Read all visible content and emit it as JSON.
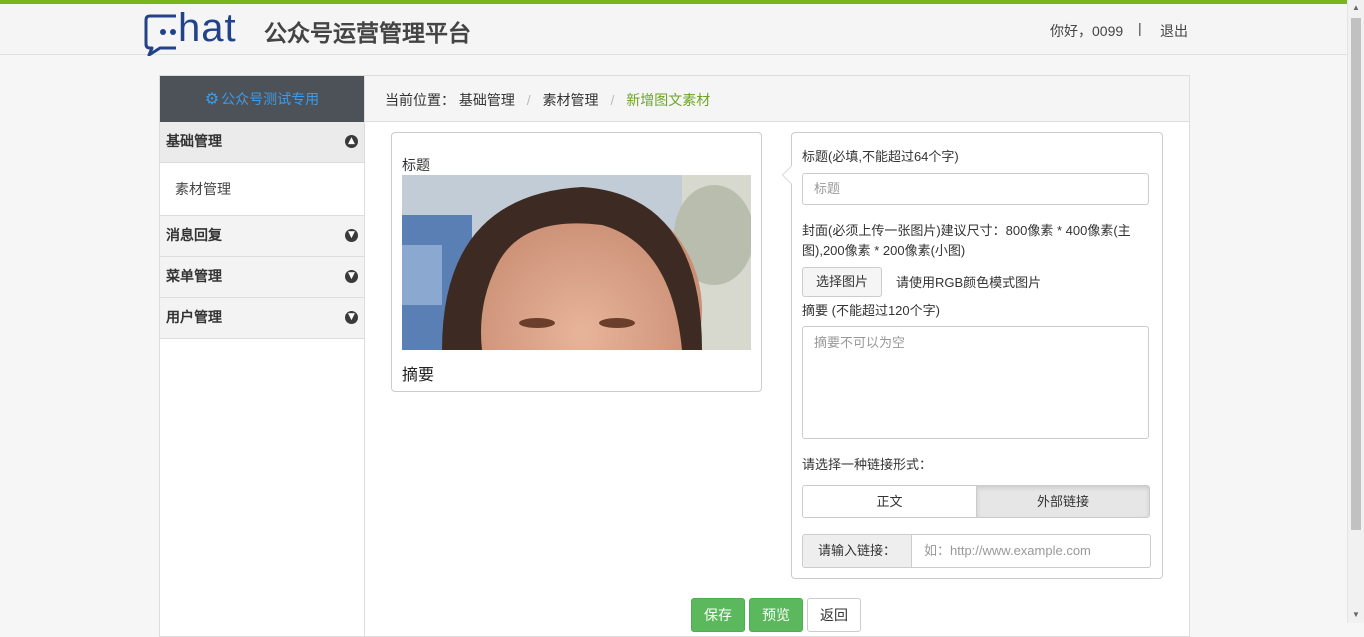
{
  "header": {
    "logo_text": "hat",
    "platform_title": "公众号运营管理平台",
    "greeting": "你好，0099",
    "separator": "|",
    "logout": "退出"
  },
  "sidebar": {
    "account_name": "公众号测试专用",
    "account_icon": "gear-icon",
    "menus": [
      {
        "label": "基础管理",
        "icon": "arrow-up-circle-icon",
        "expanded": true,
        "children": [
          "素材管理"
        ]
      },
      {
        "label": "消息回复",
        "icon": "arrow-down-circle-icon",
        "expanded": false
      },
      {
        "label": "菜单管理",
        "icon": "arrow-down-circle-icon",
        "expanded": false
      },
      {
        "label": "用户管理",
        "icon": "arrow-down-circle-icon",
        "expanded": false
      }
    ]
  },
  "breadcrumb": {
    "prefix": "当前位置：",
    "items": [
      "基础管理",
      "素材管理",
      "新增图文素材"
    ]
  },
  "preview": {
    "title": "标题",
    "summary": "摘要"
  },
  "form": {
    "title_label": "标题(必填,不能超过64个字)",
    "title_placeholder": "标题",
    "cover_label": "封面(必须上传一张图片)建议尺寸：800像素 * 400像素(主图),200像素 * 200像素(小图)",
    "choose_image": "选择图片",
    "rgb_hint": "请使用RGB颜色模式图片",
    "summary_label": "摘要 (不能超过120个字)",
    "summary_placeholder": "摘要不可以为空",
    "link_type_label": "请选择一种链接形式：",
    "link_type_options": [
      "正文",
      "外部链接"
    ],
    "link_type_selected": "外部链接",
    "link_addon": "请输入链接：",
    "link_placeholder": "如：http://www.example.com"
  },
  "actions": {
    "save": "保存",
    "preview": "预览",
    "back": "返回"
  },
  "colors": {
    "accent_green": "#78b51e",
    "button_green": "#5cb85c",
    "account_blue": "#3d9be9",
    "logo_blue": "#22438a"
  }
}
